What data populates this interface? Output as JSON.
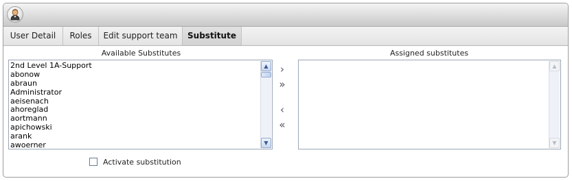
{
  "tabs": [
    {
      "label": "User Detail",
      "active": false
    },
    {
      "label": "Roles",
      "active": false
    },
    {
      "label": "Edit support team",
      "active": false
    },
    {
      "label": "Substitute",
      "active": true
    }
  ],
  "available": {
    "label": "Available Substitutes",
    "items": [
      "2nd Level 1A-Support",
      "abonow",
      "abraun",
      "Administrator",
      "aeisenach",
      "ahoreglad",
      "aortmann",
      "apichowski",
      "arank",
      "awoerner"
    ]
  },
  "assigned": {
    "label": "Assigned substitutes",
    "items": []
  },
  "transfer": {
    "add_one": "›",
    "add_all": "»",
    "remove_one": "‹",
    "remove_all": "«"
  },
  "activate": {
    "label": "Activate substitution",
    "checked": false
  }
}
